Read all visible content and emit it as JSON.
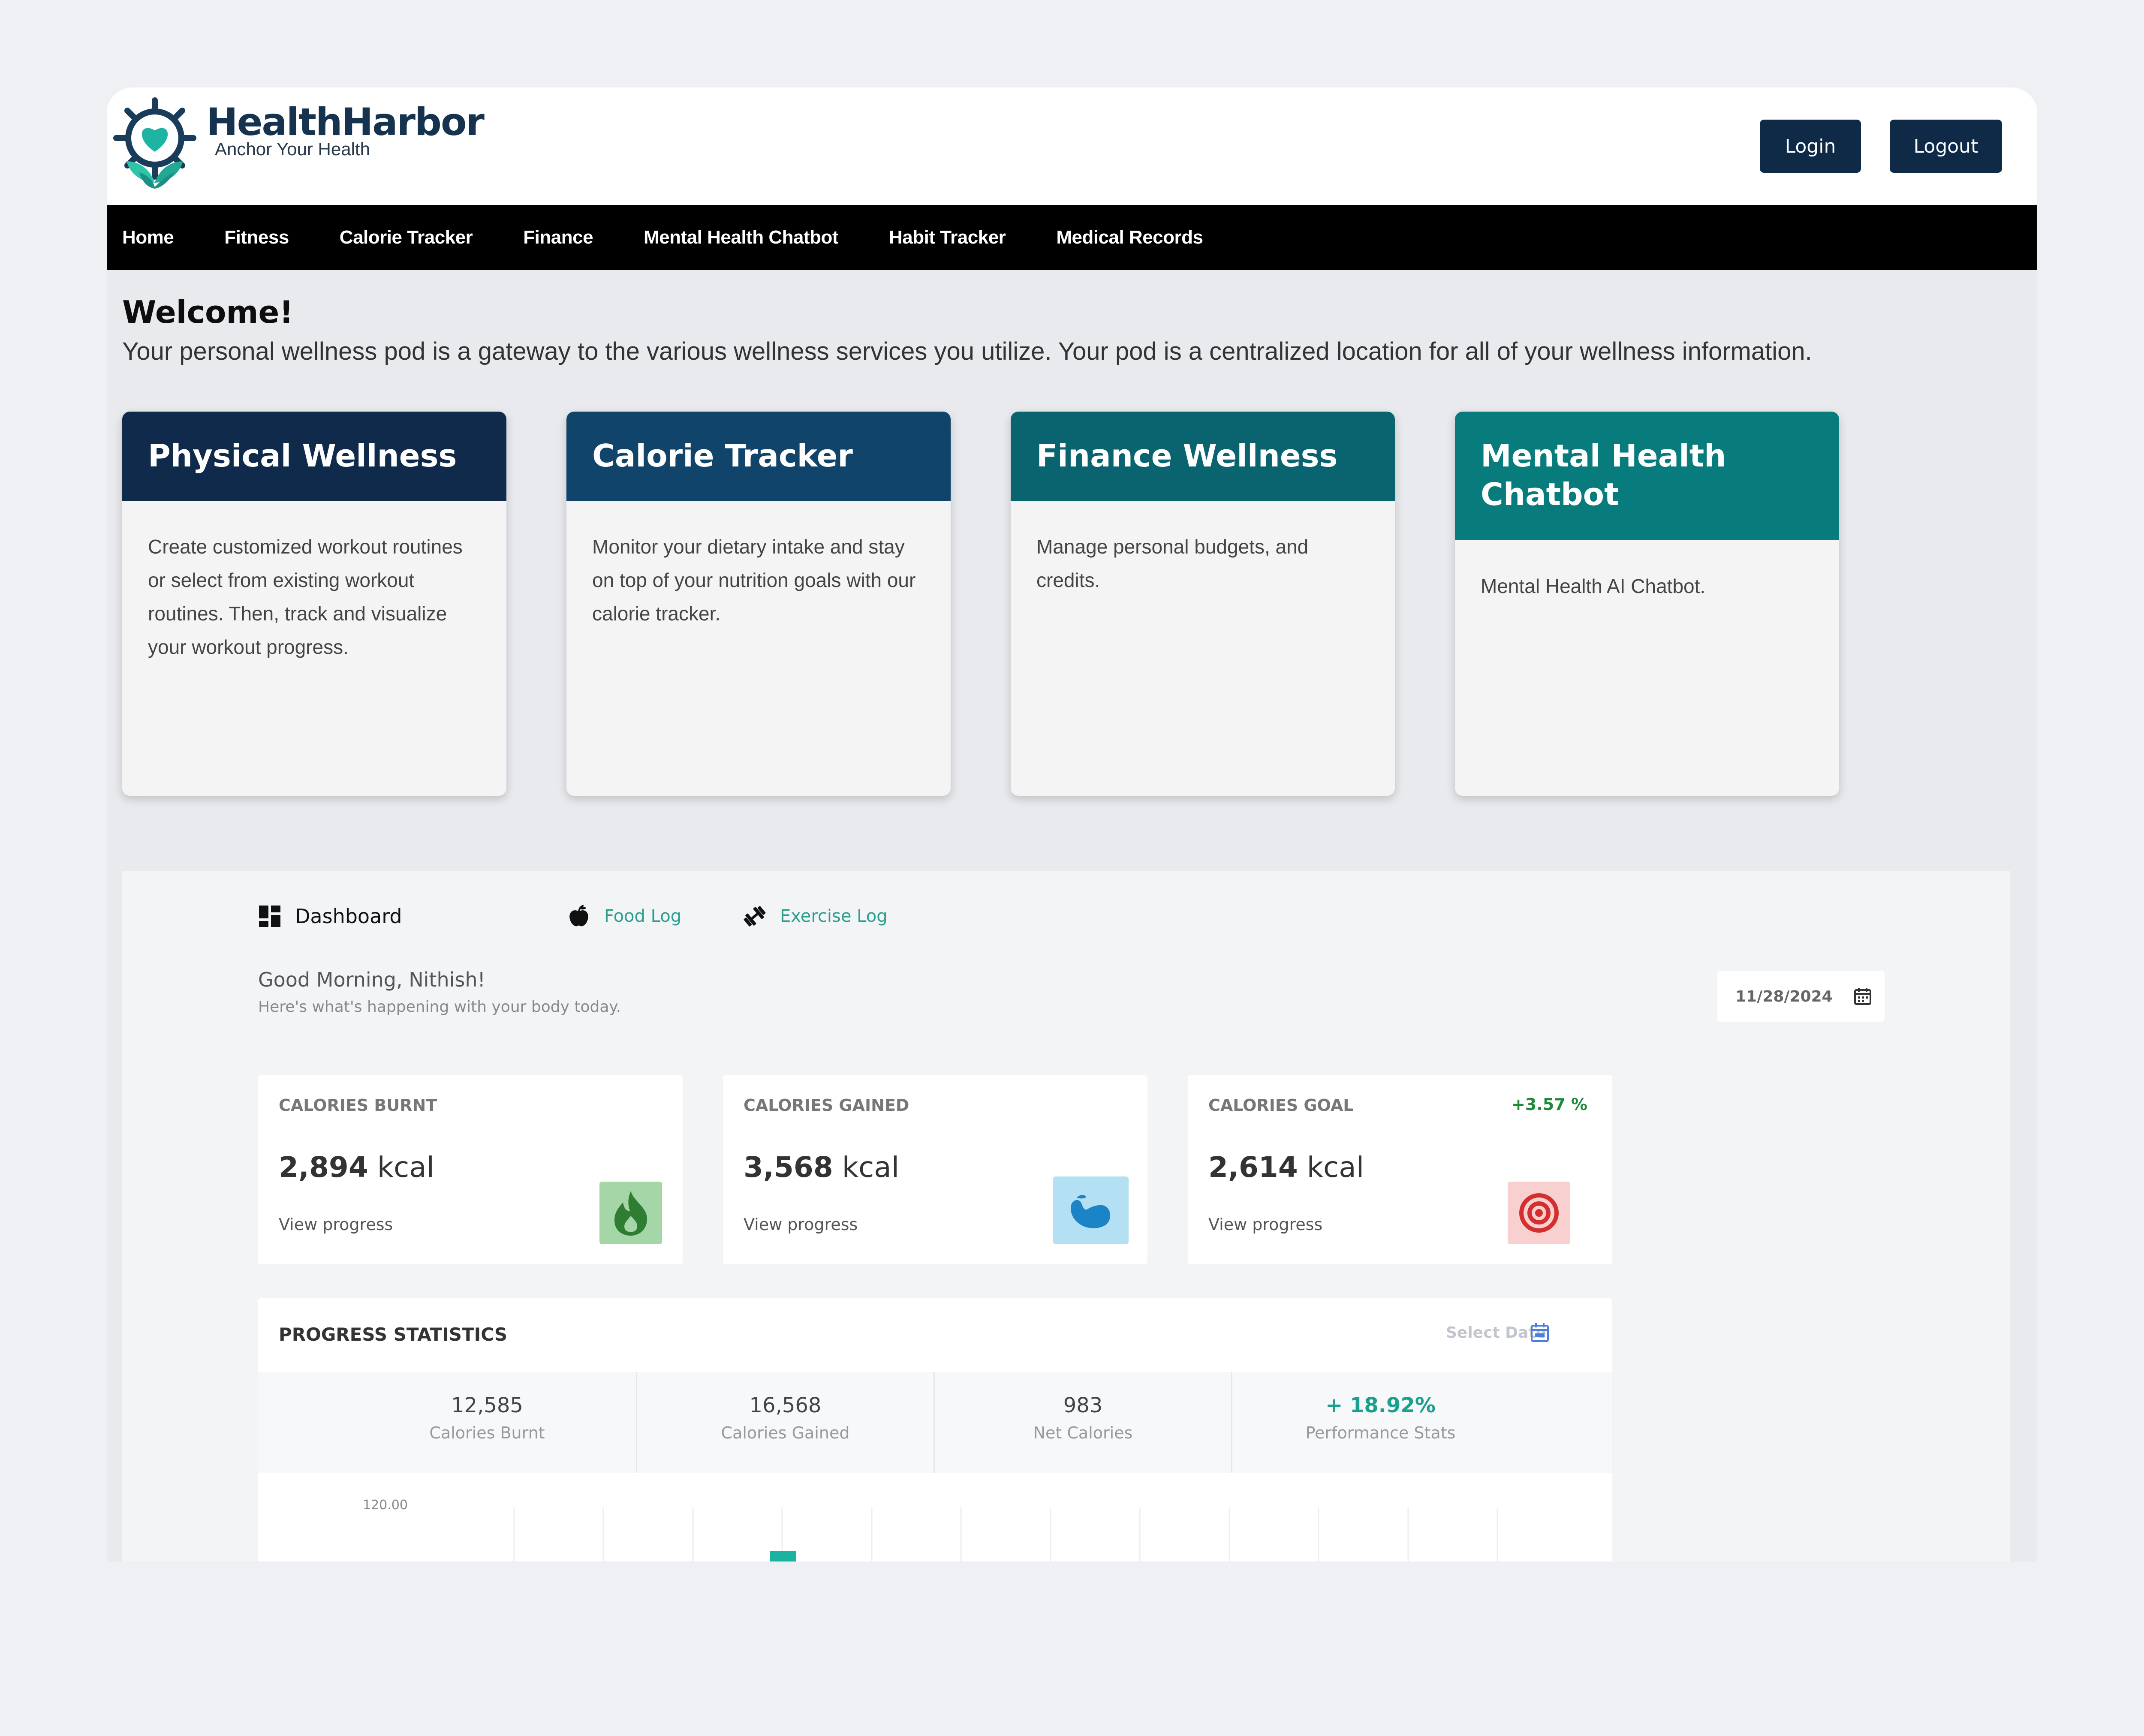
{
  "header": {
    "brand_name": "HealthHarbor",
    "brand_tagline": "Anchor Your Health",
    "login_label": "Login",
    "logout_label": "Logout"
  },
  "nav": {
    "items": [
      "Home",
      "Fitness",
      "Calorie Tracker",
      "Finance",
      "Mental Health Chatbot",
      "Habit Tracker",
      "Medical Records"
    ]
  },
  "welcome": {
    "title": "Welcome!",
    "text": "Your personal wellness pod is a gateway to the various wellness services you utilize. Your pod is a centralized location for all of your wellness information."
  },
  "cards": [
    {
      "title": "Physical Wellness",
      "body": "Create customized workout routines or select from existing workout routines. Then, track and visualize your workout progress.",
      "color": "#0f2a4a"
    },
    {
      "title": "Calorie Tracker",
      "body": "Monitor your dietary intake and stay on top of your nutrition goals with our calorie tracker.",
      "color": "#10446a"
    },
    {
      "title": "Finance Wellness",
      "body": "Manage personal budgets, and credits.",
      "color": "#0a6470"
    },
    {
      "title": "Mental Health Chatbot",
      "body": "Mental Health AI Chatbot.",
      "color": "#087c7c"
    }
  ],
  "dashboard": {
    "tabs": [
      {
        "label": "Dashboard",
        "icon": "dashboard-grid-icon"
      },
      {
        "label": "Food Log",
        "icon": "apple-icon"
      },
      {
        "label": "Exercise Log",
        "icon": "dumbbell-icon"
      }
    ],
    "greeting": "Good Morning, Nithish!",
    "greeting_sub": "Here's what's happening with your body today.",
    "date": "11/28/2024",
    "stats": [
      {
        "label": "CALORIES BURNT",
        "value": "2,894",
        "unit": "kcal",
        "link": "View progress",
        "delta": "",
        "icon": "flame-icon",
        "icon_bg": "#a5d6a7",
        "icon_color": "#2e7d32"
      },
      {
        "label": "CALORIES GAINED",
        "value": "3,568",
        "unit": "kcal",
        "link": "View progress",
        "delta": "",
        "icon": "muscle-icon",
        "icon_bg": "#b3e0f2",
        "icon_color": "#1a84c7"
      },
      {
        "label": "CALORIES GOAL",
        "value": "2,614",
        "unit": "kcal",
        "link": "View progress",
        "delta": "+3.57 %",
        "icon": "target-icon",
        "icon_bg": "#f8d0d0",
        "icon_color": "#d32f2f"
      }
    ],
    "progress": {
      "title": "PROGRESS STATISTICS",
      "date_placeholder": "Select Date",
      "cells": [
        {
          "value": "12,585",
          "label": "Calories Burnt"
        },
        {
          "value": "16,568",
          "label": "Calories Gained"
        },
        {
          "value": "983",
          "label": "Net Calories"
        },
        {
          "value": "+ 18.92%",
          "label": "Performance Stats"
        }
      ],
      "chart_tick": "120.00"
    }
  },
  "colors": {
    "accent_teal": "#1bb3a0",
    "brand_navy": "#0e2a47"
  }
}
